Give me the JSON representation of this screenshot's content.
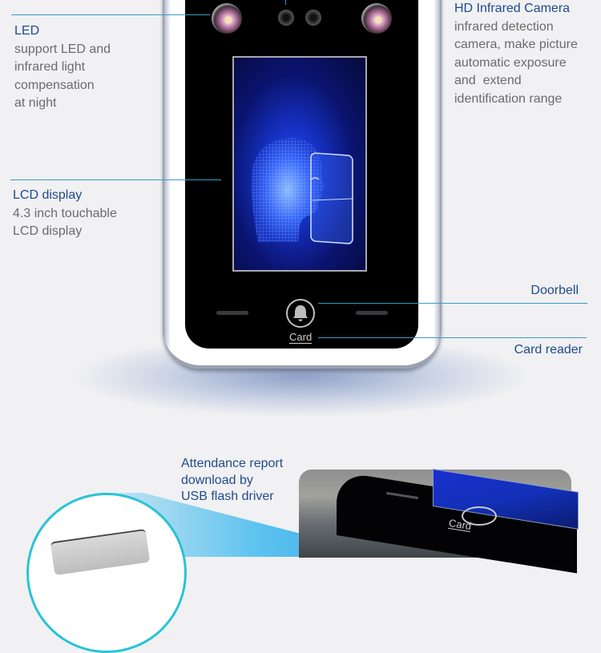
{
  "features": {
    "led": {
      "title": "LED",
      "description": [
        "support LED and",
        "infrared light",
        "compensation",
        "at night"
      ]
    },
    "camera": {
      "title": "HD Infrared Camera",
      "description": [
        "infrared detection",
        "camera, make picture",
        "automatic exposure",
        "and  extend",
        "identification range"
      ]
    },
    "lcd": {
      "title": "LCD display",
      "description": [
        "4.3 inch touchable",
        "LCD display"
      ]
    },
    "doorbell": {
      "title": "Doorbell"
    },
    "card_reader": {
      "title": "Card reader"
    },
    "usb": {
      "description": [
        "Attendance report",
        "download by",
        "USB flash driver"
      ]
    }
  },
  "device": {
    "card_label": "Card",
    "doorbell_icon": "bell-icon",
    "screen_image": "wireframe-face-scan"
  },
  "colors": {
    "title": "#1f4a8c",
    "description": "#6b6b6f",
    "callout_line": "#3a9bc8",
    "background": "#f1f1f3",
    "usb_circle": "#27c4d4"
  }
}
